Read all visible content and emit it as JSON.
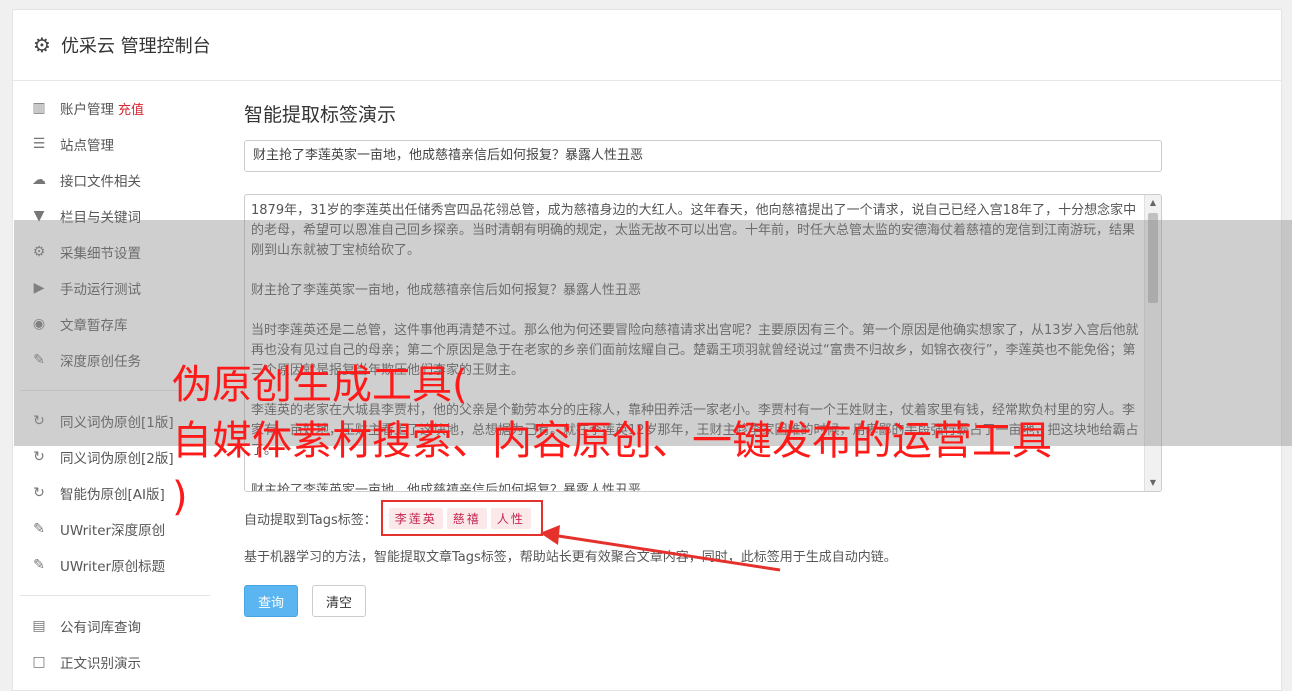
{
  "header": {
    "title": "优采云 管理控制台"
  },
  "sidebar": {
    "group1": [
      {
        "label": "账户管理",
        "badge": "充值",
        "icon": "bar-chart-icon"
      },
      {
        "label": "站点管理",
        "icon": "server-icon"
      },
      {
        "label": "接口文件相关",
        "icon": "cloud-upload-icon"
      },
      {
        "label": "栏目与关键词",
        "icon": "filter-icon"
      },
      {
        "label": "采集细节设置",
        "icon": "gears-icon"
      },
      {
        "label": "手动运行测试",
        "icon": "play-circle-icon"
      },
      {
        "label": "文章暂存库",
        "icon": "database-icon"
      },
      {
        "label": "深度原创任务",
        "icon": "edit-icon"
      }
    ],
    "group2": [
      {
        "label": "同义词伪原创[1版]",
        "icon": "refresh-icon"
      },
      {
        "label": "同义词伪原创[2版]",
        "icon": "refresh-icon"
      },
      {
        "label": "智能伪原创[AI版]",
        "icon": "refresh-icon"
      },
      {
        "label": "UWriter深度原创",
        "icon": "edit-icon"
      },
      {
        "label": "UWriter原创标题",
        "icon": "edit-icon"
      }
    ],
    "group3": [
      {
        "label": "公有词库查询",
        "icon": "book-icon"
      },
      {
        "label": "正文识别演示",
        "icon": "square-icon"
      }
    ]
  },
  "main": {
    "heading": "智能提取标签演示",
    "title_value": "财主抢了李莲英家一亩地，他成慈禧亲信后如何报复？暴露人性丑恶",
    "body_paragraphs": [
      "1879年，31岁的李莲英出任储秀宫四品花翎总管，成为慈禧身边的大红人。这年春天，他向慈禧提出了一个请求，说自己已经入宫18年了，十分想念家中的老母，希望可以恩准自己回乡探亲。当时清朝有明确的规定，太监无故不可以出宫。十年前，时任大总管太监的安德海仗着慈禧的宠信到江南游玩，结果刚到山东就被丁宝桢给砍了。",
      "财主抢了李莲英家一亩地，他成慈禧亲信后如何报复？暴露人性丑恶",
      "当时李莲英还是二总管，这件事他再清楚不过。那么他为何还要冒险向慈禧请求出宫呢？主要原因有三个。第一个原因是他确实想家了，从13岁入宫后他就再也没有见过自己的母亲；第二个原因是急于在老家的乡亲们面前炫耀自己。楚霸王项羽就曾经说过“富贵不归故乡，如锦衣夜行”，李莲英也不能免俗；第三个原因就是报复当年欺压他们李家的王财主。",
      "李莲英的老家在大城县李贾村，他的父亲是个勤劳本分的庄稼人，靠种田养活一家老小。李贾村有一个王姓财主，仗着家里有钱，经常欺负村里的穷人。李家有一亩好地，王财主看上了这块地，总想据为己有。就在李莲英12岁那年，王财主趁李家困难的时候，用卑鄙的手段强行霸占了一亩地，把这块地给霸占了。",
      "财主抢了李莲英家一亩地，他成慈禧亲信后如何报复？暴露人性丑恶"
    ],
    "tags_label": "自动提取到Tags标签：",
    "tags": [
      "李莲英",
      "慈禧",
      "人性"
    ],
    "note": "基于机器学习的方法，智能提取文章Tags标签，帮助站长更有效聚合文章内容，同时，此标签用于生成自动内链。",
    "query_button": "查询",
    "clear_button": "清空"
  },
  "overlay": {
    "line1": "伪原创生成工具(",
    "line2": "自媒体素材搜索、内容原创、一键发布的运营工具",
    "line3": ")",
    "color": "#ff1a1a"
  }
}
